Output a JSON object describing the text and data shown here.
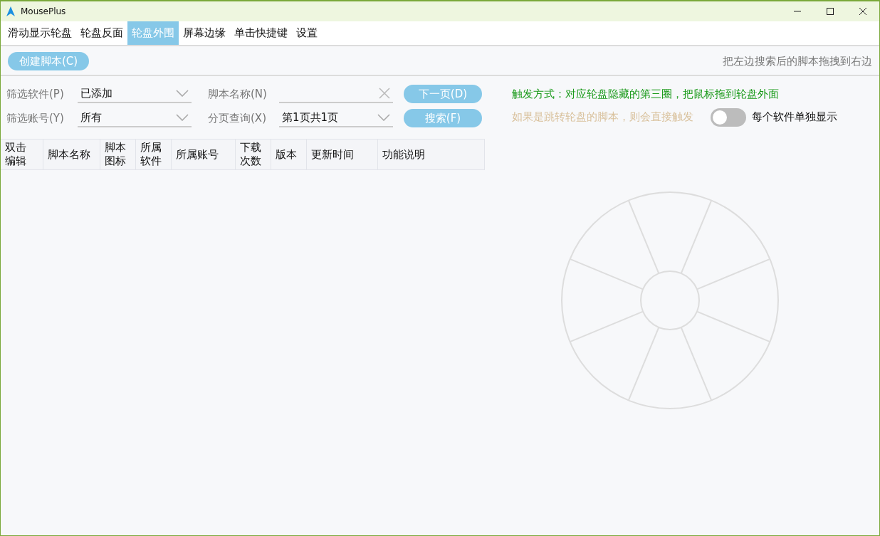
{
  "window": {
    "title": "MousePlus"
  },
  "tabs": [
    {
      "label": "滑动显示轮盘",
      "selected": false
    },
    {
      "label": "轮盘反面",
      "selected": false
    },
    {
      "label": "轮盘外围",
      "selected": true
    },
    {
      "label": "屏幕边缘",
      "selected": false
    },
    {
      "label": "单击快捷键",
      "selected": false
    },
    {
      "label": "设置",
      "selected": false
    }
  ],
  "toolbar": {
    "create_button": "创建脚本(C)",
    "hint": "把左边搜索后的脚本拖拽到右边"
  },
  "filters": {
    "software": {
      "label": "筛选软件(P)",
      "value": "已添加"
    },
    "account": {
      "label": "筛选账号(Y)",
      "value": "所有"
    },
    "script_name": {
      "label": "脚本名称(N)"
    },
    "paging": {
      "label": "分页查询(X)",
      "value": "第1页共1页"
    },
    "next_button": "下一页(D)",
    "search_button": "搜索(F)"
  },
  "table": {
    "columns": [
      "双击编辑",
      "脚本名称",
      "脚本图标",
      "所属软件",
      "所属账号",
      "下载次数",
      "版本",
      "更新时间",
      "功能说明"
    ]
  },
  "trigger_info": "触发方式：对应轮盘隐藏的第三圈，把鼠标拖到轮盘外面",
  "jump_info": "如果是跳转轮盘的脚本，则会直接触发",
  "toggle": {
    "label": "每个软件单独显示",
    "on": false
  }
}
